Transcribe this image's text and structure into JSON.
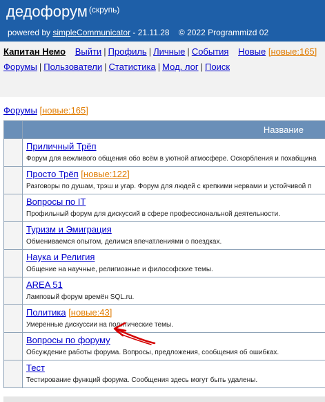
{
  "header": {
    "title": "дедофорум",
    "subtitle": "(скрупь)",
    "powered_prefix": "powered by ",
    "powered_link": "simpleCommunicator",
    "powered_suffix": " - 21.11.28    © 2022 Programmizd 02"
  },
  "nav": {
    "username": "Капитан Немо",
    "row1": [
      "Выйти",
      "Профиль",
      "Личные",
      "События"
    ],
    "new_link": "Новые",
    "new_count": "[новые:165]",
    "row2": [
      "Форумы",
      "Пользователи",
      "Статистика",
      "Мод. лог",
      "Поиск"
    ]
  },
  "crumbs": {
    "forums": "Форумы",
    "new_count": "[новые:165]"
  },
  "table": {
    "header_name": "Название"
  },
  "forums": [
    {
      "name": "Приличный Трёп",
      "new": "",
      "desc": "Форум для вежливого общения обо всём в уютной атмосфере. Оскорбления и похабщина",
      "mark": "["
    },
    {
      "name": "Просто Трёп",
      "new": "[новые:122]",
      "desc": "Разговоры по душам, трэш и угар. Форум для людей с крепкими нервами и устойчивой п",
      "mark": ""
    },
    {
      "name": "Вопросы по IT",
      "new": "",
      "desc": "Профильный форум для дискуссий в сфере профессиональной деятельности.",
      "mark": "["
    },
    {
      "name": "Туризм и Эмиграция",
      "new": "",
      "desc": "Обмениваемся опытом, делимся впечатлениями о поездках.",
      "mark": ""
    },
    {
      "name": "Наука и Религия",
      "new": "",
      "desc": "Общение на научные, религиозные и философские темы.",
      "mark": "["
    },
    {
      "name": "AREA 51",
      "new": "",
      "desc": "Ламповый форум времён SQL.ru.",
      "mark": ""
    },
    {
      "name": "Политика",
      "new": "[новые:43]",
      "desc": "Умеренные дискуссии на политические темы.",
      "mark": ""
    },
    {
      "name": "Вопросы по форуму",
      "new": "",
      "desc": "Обсуждение работы форума. Вопросы, предложения, сообщения об ошибках.",
      "mark": ""
    },
    {
      "name": "Тест",
      "new": "",
      "desc": "Тестирование функций форума. Сообщения здесь могут быть удалены.",
      "mark": ""
    }
  ],
  "colors": {
    "header_bg": "#1e5fa8",
    "table_header_bg": "#6a8fb8",
    "link": "#0000cc",
    "new_badge": "#e07b00",
    "annotation": "#d40000"
  }
}
